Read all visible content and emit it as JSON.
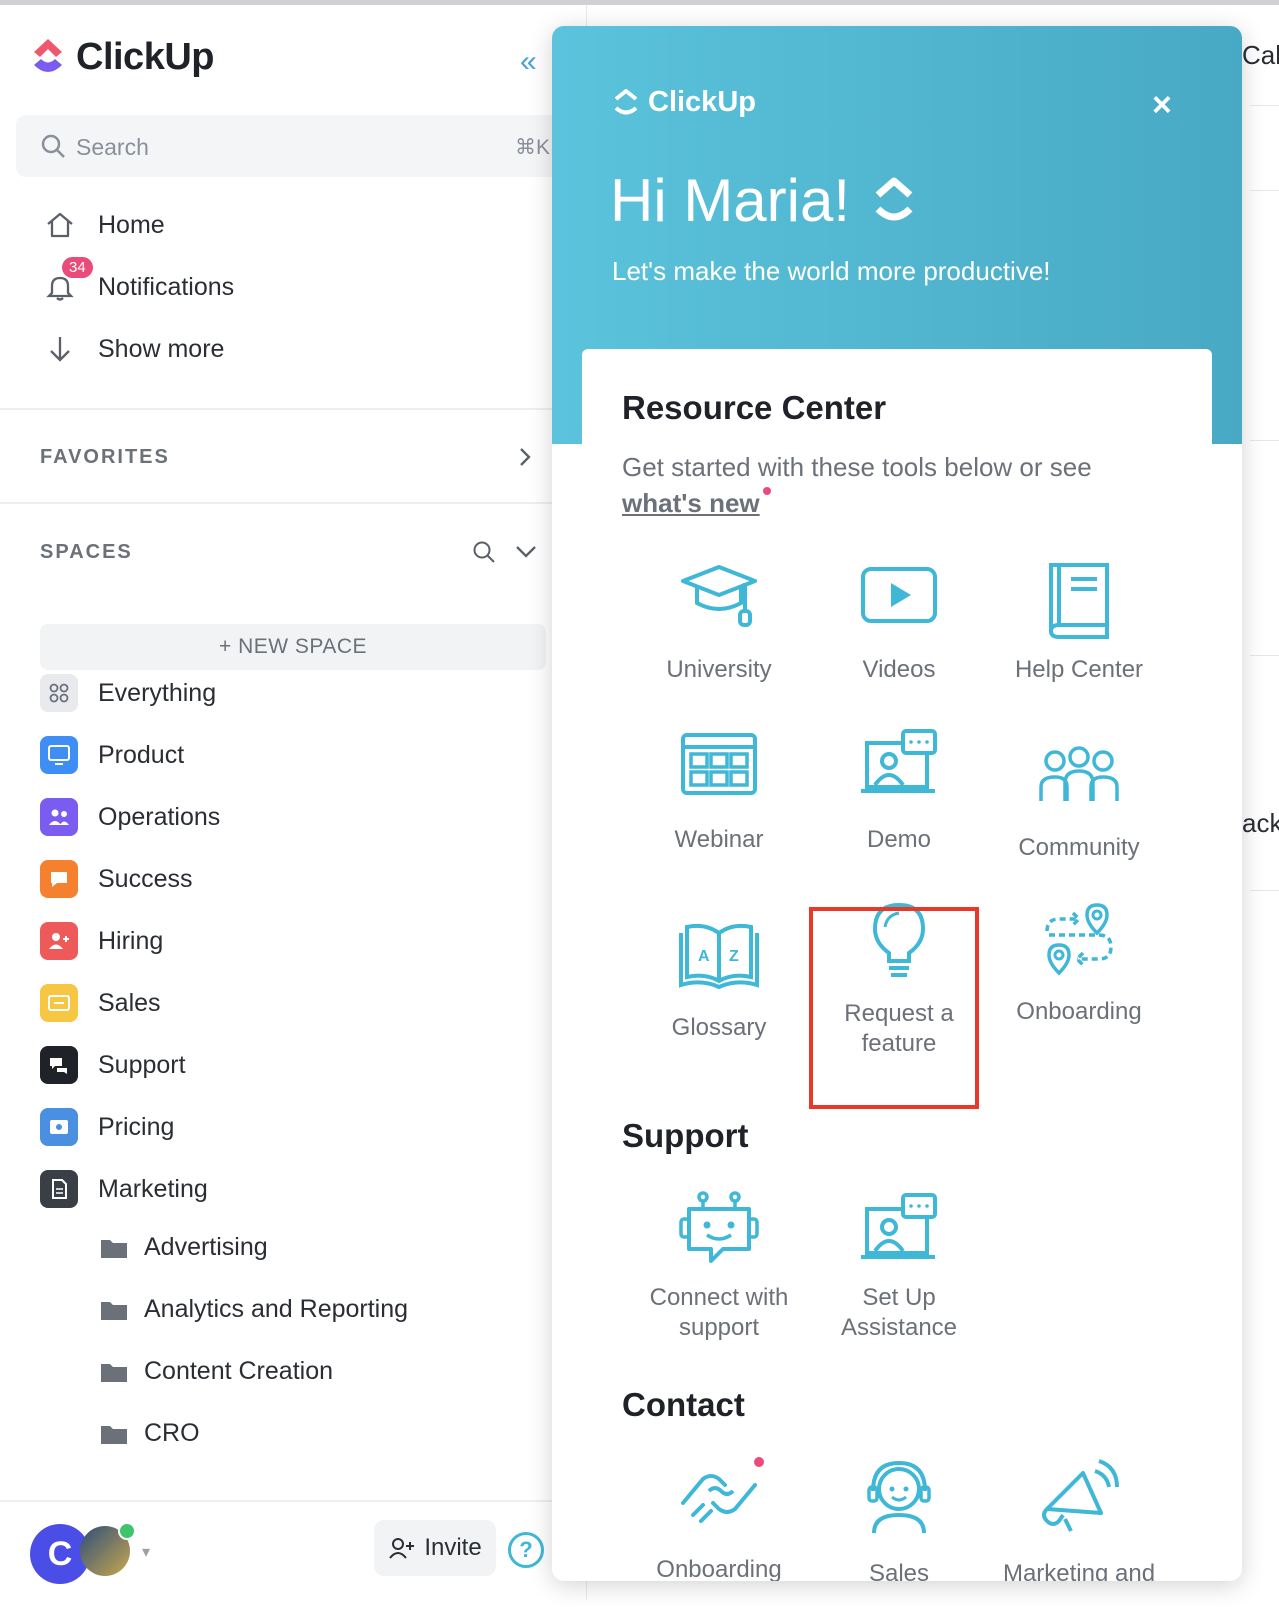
{
  "brand": {
    "name": "ClickUp",
    "accent": "#3fb7d6",
    "header_gradient": [
      "#5bc3dc",
      "#48a9c4"
    ],
    "badge_color": "#e94b7b",
    "highlight_color": "#e8382a"
  },
  "sidebar": {
    "search": {
      "placeholder": "Search",
      "shortcut": "⌘K"
    },
    "nav": [
      {
        "label": "Home",
        "icon": "home-icon"
      },
      {
        "label": "Notifications",
        "icon": "bell-icon",
        "badge": "34"
      },
      {
        "label": "Show more",
        "icon": "arrow-down-icon"
      }
    ],
    "favorites_title": "FAVORITES",
    "spaces_title": "SPACES",
    "new_space_label": "+ NEW SPACE",
    "spaces": [
      {
        "label": "Everything",
        "color": "#e9eaed"
      },
      {
        "label": "Product",
        "color": "#3f8ef5"
      },
      {
        "label": "Operations",
        "color": "#7b5cf0"
      },
      {
        "label": "Success",
        "color": "#f5812f"
      },
      {
        "label": "Hiring",
        "color": "#ee5a5a"
      },
      {
        "label": "Sales",
        "color": "#f7c744"
      },
      {
        "label": "Support",
        "color": "#1f2228"
      },
      {
        "label": "Pricing",
        "color": "#4a8fe0"
      },
      {
        "label": "Marketing",
        "color": "#3a3f47"
      }
    ],
    "folders": [
      "Advertising",
      "Analytics and Reporting",
      "Content Creation",
      "CRO"
    ],
    "workspace_initial": "C",
    "invite_label": "Invite",
    "help_label": "?"
  },
  "background_fragments": {
    "top": "Cal",
    "middle": "ack"
  },
  "panel": {
    "logo": "ClickUp",
    "close_label": "×",
    "greeting": "Hi Maria!",
    "subtitle": "Let's make the world more productive!",
    "resource_center": {
      "title": "Resource Center",
      "desc": "Get started with these tools below or see",
      "link": "what's new",
      "tiles": [
        {
          "label": "University",
          "icon": "graduation-cap-icon"
        },
        {
          "label": "Videos",
          "icon": "video-play-icon"
        },
        {
          "label": "Help Center",
          "icon": "book-icon"
        },
        {
          "label": "Webinar",
          "icon": "webinar-grid-icon"
        },
        {
          "label": "Demo",
          "icon": "demo-laptop-icon"
        },
        {
          "label": "Community",
          "icon": "community-people-icon"
        },
        {
          "label": "Glossary",
          "icon": "glossary-book-icon"
        },
        {
          "label": "Request a feature",
          "icon": "lightbulb-icon",
          "highlighted": true
        },
        {
          "label": "Onboarding",
          "icon": "onboarding-route-icon"
        }
      ]
    },
    "support": {
      "title": "Support",
      "tiles": [
        {
          "label": "Connect with support",
          "icon": "robot-chat-icon"
        },
        {
          "label": "Set Up Assistance",
          "icon": "setup-laptop-icon"
        }
      ]
    },
    "contact": {
      "title": "Contact",
      "tiles": [
        {
          "label": "Onboarding",
          "icon": "handshake-icon"
        },
        {
          "label": "Sales",
          "icon": "headset-person-icon"
        },
        {
          "label": "Marketing and",
          "icon": "megaphone-icon"
        }
      ]
    }
  }
}
